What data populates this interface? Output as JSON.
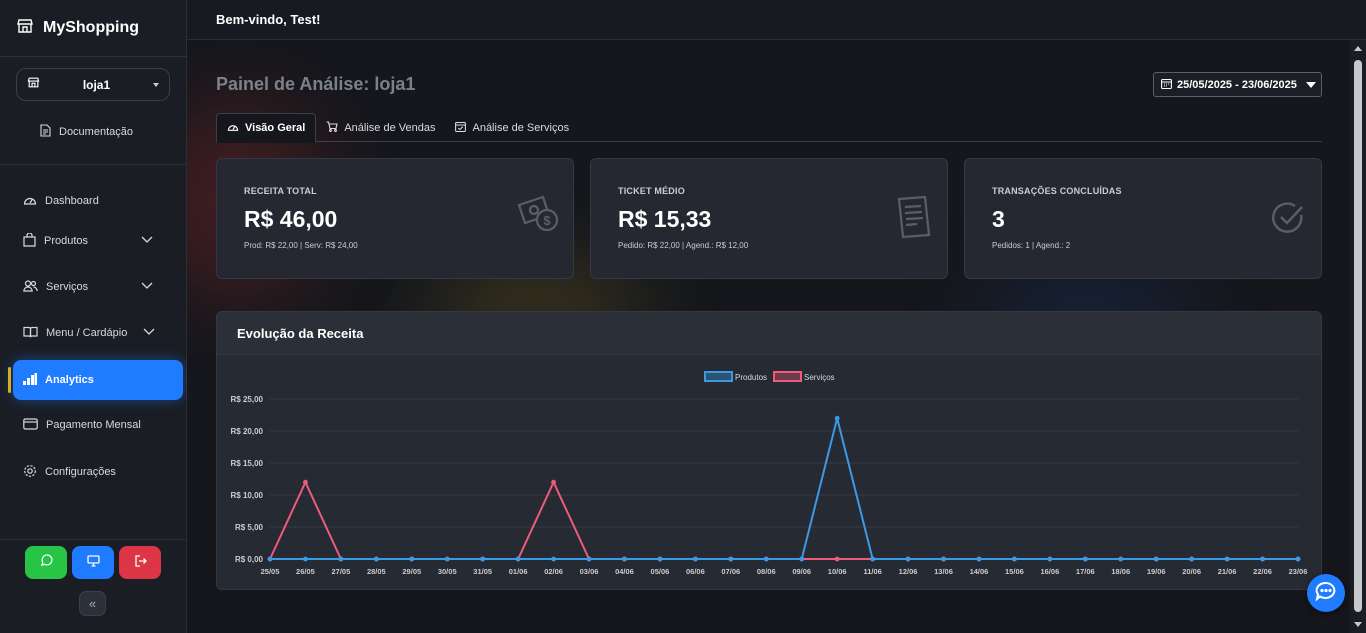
{
  "brand": {
    "name": "MyShopping",
    "icon": "store-icon"
  },
  "store_selector": {
    "value": "loja1",
    "icon": "store-icon"
  },
  "docs": {
    "label": "Documentação",
    "icon": "document-icon"
  },
  "nav": [
    {
      "label": "Dashboard",
      "icon": "gauge-icon",
      "expandable": false,
      "active": false
    },
    {
      "label": "Produtos",
      "icon": "bag-icon",
      "expandable": true,
      "active": false
    },
    {
      "label": "Serviços",
      "icon": "people-icon",
      "expandable": true,
      "active": false
    },
    {
      "label": "Menu / Cardápio",
      "icon": "book-icon",
      "expandable": true,
      "active": false
    },
    {
      "label": "Analytics",
      "icon": "bar-chart-icon",
      "expandable": false,
      "active": true
    },
    {
      "label": "Pagamento Mensal",
      "icon": "credit-card-icon",
      "expandable": false,
      "active": false
    },
    {
      "label": "Configurações",
      "icon": "gear-icon",
      "expandable": false,
      "active": false
    }
  ],
  "sidebar_buttons": [
    {
      "icon": "whatsapp-icon",
      "color": "#28c445"
    },
    {
      "icon": "monitor-icon",
      "color": "#1f7bff"
    },
    {
      "icon": "logout-icon",
      "color": "#dc3545"
    }
  ],
  "collapse": {
    "icon": "double-chevron-left-icon",
    "glyph": "«"
  },
  "header": {
    "welcome": "Bem-vindo, Test!"
  },
  "page": {
    "title": "Painel de Análise: loja1",
    "date_range": "25/05/2025 - 23/06/2025"
  },
  "tabs": [
    {
      "label": "Visão Geral",
      "icon": "gauge-icon",
      "active": true
    },
    {
      "label": "Análise de Vendas",
      "icon": "cart-icon",
      "active": false
    },
    {
      "label": "Análise de Serviços",
      "icon": "calendar-check-icon",
      "active": false
    }
  ],
  "cards": [
    {
      "label": "RECEITA TOTAL",
      "value": "R$ 46,00",
      "sub": "Prod: R$ 22,00 | Serv: R$ 24,00",
      "icon": "money-icon"
    },
    {
      "label": "TICKET MÉDIO",
      "value": "R$ 15,33",
      "sub": "Pedido: R$ 22,00 | Agend.: R$ 12,00",
      "icon": "receipt-icon"
    },
    {
      "label": "TRANSAÇÕES CONCLUÍDAS",
      "value": "3",
      "sub": "Pedidos: 1 | Agend.: 2",
      "icon": "check-circle-icon"
    }
  ],
  "chart_title": "Evolução da Receita",
  "chart_data": {
    "type": "line",
    "title": "",
    "xlabel": "",
    "ylabel": "",
    "ylim": [
      0,
      25
    ],
    "y_ticks": [
      "R$ 0,00",
      "R$ 5,00",
      "R$ 10,00",
      "R$ 15,00",
      "R$ 20,00",
      "R$ 25,00"
    ],
    "grid": true,
    "legend": "top-center",
    "x": [
      "25/05",
      "26/05",
      "27/05",
      "28/05",
      "29/05",
      "30/05",
      "31/05",
      "01/06",
      "02/06",
      "03/06",
      "04/06",
      "05/06",
      "06/06",
      "07/06",
      "08/06",
      "09/06",
      "10/06",
      "11/06",
      "12/06",
      "13/06",
      "14/06",
      "15/06",
      "16/06",
      "17/06",
      "18/06",
      "19/06",
      "20/06",
      "21/06",
      "22/06",
      "23/06"
    ],
    "series": [
      {
        "name": "Produtos",
        "color": "#3b9ae6",
        "values": [
          0,
          0,
          0,
          0,
          0,
          0,
          0,
          0,
          0,
          0,
          0,
          0,
          0,
          0,
          0,
          0,
          22,
          0,
          0,
          0,
          0,
          0,
          0,
          0,
          0,
          0,
          0,
          0,
          0,
          0
        ]
      },
      {
        "name": "Serviços",
        "color": "#ef5b7b",
        "values": [
          0,
          12,
          0,
          0,
          0,
          0,
          0,
          0,
          12,
          0,
          0,
          0,
          0,
          0,
          0,
          0,
          0,
          0,
          0,
          0,
          0,
          0,
          0,
          0,
          0,
          0,
          0,
          0,
          0,
          0
        ]
      }
    ]
  }
}
